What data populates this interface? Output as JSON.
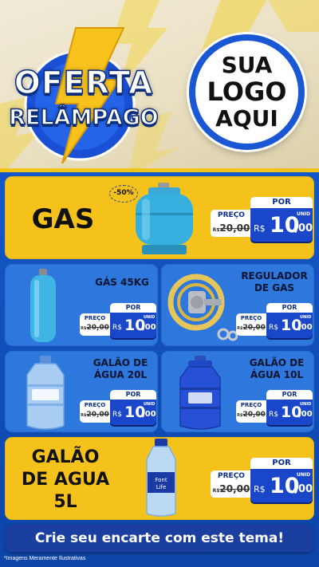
{
  "header": {
    "offer_line1": "OFERTA",
    "offer_line2": "RELÂMPAGO",
    "logo_line1": "SUA",
    "logo_line2": "LOGO",
    "logo_line3": "AQUI"
  },
  "colors": {
    "brand_blue": "#1a46c9",
    "accent_yellow": "#f4c21a",
    "card_blue": "#2d77dd"
  },
  "products": [
    {
      "name": "GAS",
      "discount": "-50%",
      "preco_label": "PREÇO",
      "old_price": "20,00",
      "old_currency": "R$",
      "por_label": "POR",
      "currency": "R$",
      "price_int": "10",
      "price_cents": ",00",
      "unit": "UNID"
    },
    {
      "name": "GÁS 45KG",
      "preco_label": "PREÇO",
      "old_price": "20,00",
      "old_currency": "R$",
      "por_label": "POR",
      "currency": "R$",
      "price_int": "10",
      "price_cents": ",00",
      "unit": "UNID"
    },
    {
      "name_line1": "REGULADOR",
      "name_line2": "DE GAS",
      "preco_label": "PREÇO",
      "old_price": "20,00",
      "old_currency": "R$",
      "por_label": "POR",
      "currency": "R$",
      "price_int": "10",
      "price_cents": ",00",
      "unit": "UNID"
    },
    {
      "name_line1": "GALÃO DE",
      "name_line2": "ÁGUA 20L",
      "preco_label": "PREÇO",
      "old_price": "20,00",
      "old_currency": "R$",
      "por_label": "POR",
      "currency": "R$",
      "price_int": "10",
      "price_cents": ",00",
      "unit": "UNID"
    },
    {
      "name_line1": "GALÃO DE",
      "name_line2": "ÁGUA 10L",
      "preco_label": "PREÇO",
      "old_price": "20,00",
      "old_currency": "R$",
      "por_label": "POR",
      "currency": "R$",
      "price_int": "10",
      "price_cents": ",00",
      "unit": "UNID"
    },
    {
      "name_line1": "GALÃO",
      "name_line2": "DE AGUA",
      "name_line3": "5L",
      "bottle_label_line1": "Font",
      "bottle_label_line2": "Life",
      "preco_label": "PREÇO",
      "old_price": "20,00",
      "old_currency": "R$",
      "por_label": "POR",
      "currency": "R$",
      "price_int": "10",
      "price_cents": ",00",
      "unit": "UNID"
    }
  ],
  "cta": "Crie seu encarte com este tema!",
  "disclaimer": "*Imagens Meramente Ilustrativas"
}
